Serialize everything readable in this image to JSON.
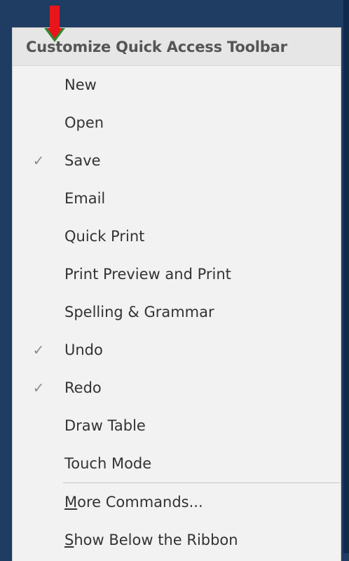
{
  "menu": {
    "header": "Customize Quick Access Toolbar",
    "items": [
      {
        "label": "New",
        "checked": false
      },
      {
        "label": "Open",
        "checked": false
      },
      {
        "label": "Save",
        "checked": true
      },
      {
        "label": "Email",
        "checked": false
      },
      {
        "label": "Quick Print",
        "checked": false
      },
      {
        "label": "Print Preview and Print",
        "checked": false
      },
      {
        "label": "Spelling & Grammar",
        "checked": false
      },
      {
        "label": "Undo",
        "checked": true
      },
      {
        "label": "Redo",
        "checked": true
      },
      {
        "label": "Draw Table",
        "checked": false
      },
      {
        "label": "Touch Mode",
        "checked": false
      }
    ],
    "footer_items": [
      {
        "accel": "M",
        "rest": "ore Commands..."
      },
      {
        "accel": "S",
        "rest": "how Below the Ribbon"
      }
    ]
  },
  "checkmark_glyph": "✓",
  "colors": {
    "background": "#1f3c63",
    "menu_bg": "#f2f2f2",
    "header_bg": "#e6e6e6",
    "arrow_red": "#e8161b",
    "arrow_green": "#2e8b2e"
  },
  "icons": {
    "annotation": "red-down-arrow-icon",
    "check": "checkmark-icon"
  }
}
